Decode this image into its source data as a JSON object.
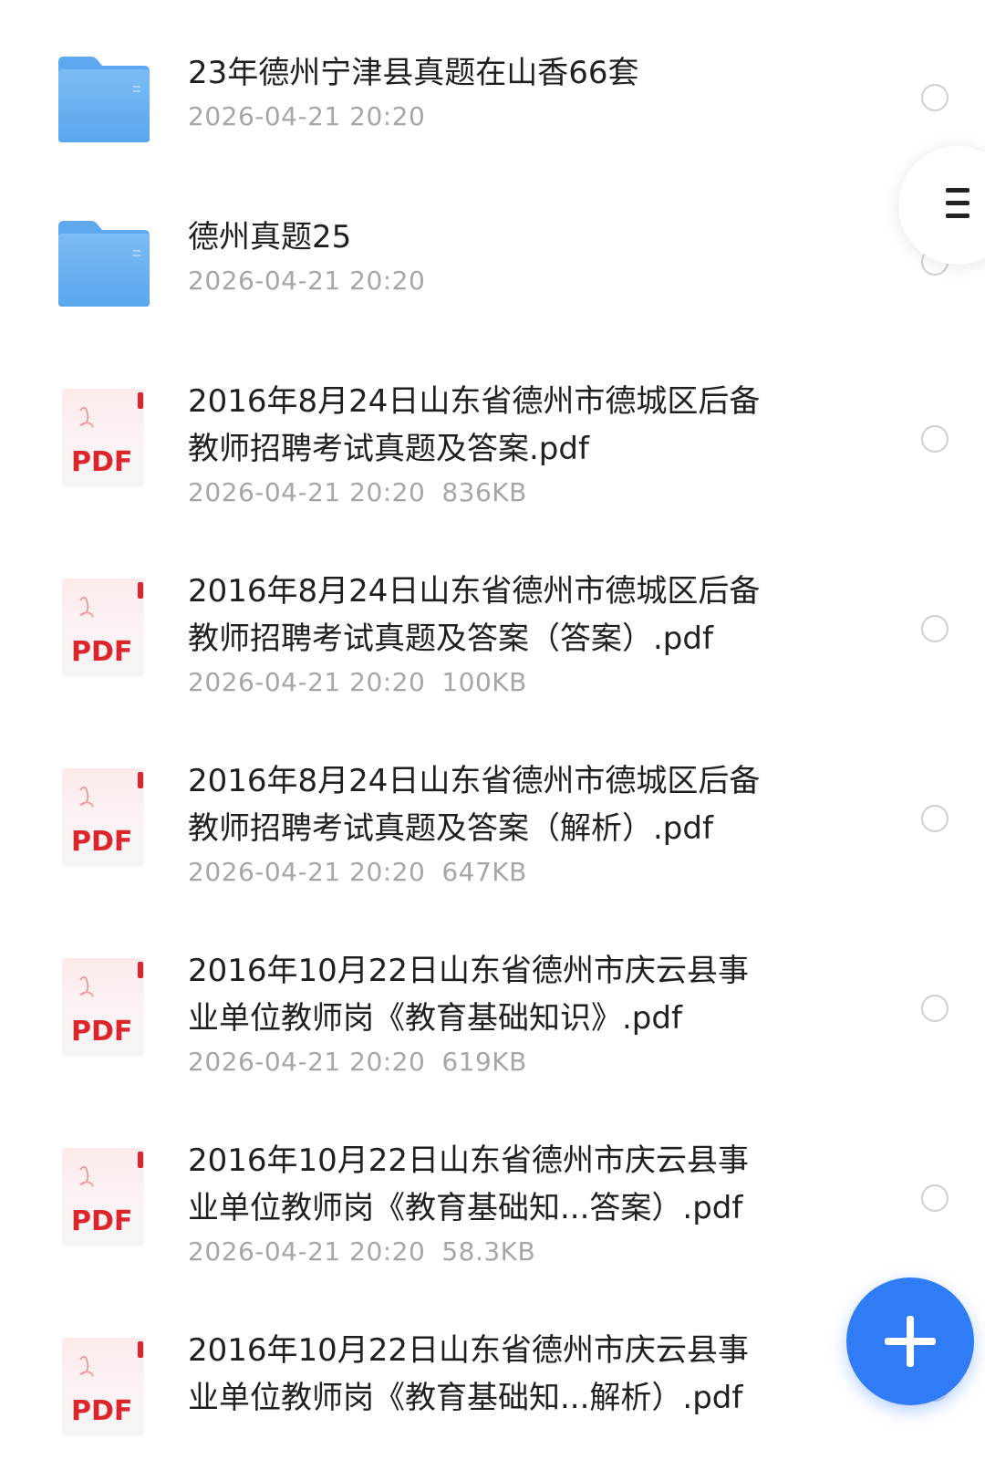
{
  "files": [
    {
      "type": "folder",
      "name_lines": [
        "23年德州宁津县真题在山香66套"
      ],
      "date": "2026-04-21 20:20",
      "size": ""
    },
    {
      "type": "folder",
      "name_lines": [
        "德州真题25"
      ],
      "date": "2026-04-21 20:20",
      "size": ""
    },
    {
      "type": "pdf",
      "name_lines": [
        "2016年8月24日山东省德州市德城区后备",
        "教师招聘考试真题及答案.pdf"
      ],
      "date": "2026-04-21 20:20",
      "size": "836KB"
    },
    {
      "type": "pdf",
      "name_lines": [
        "2016年8月24日山东省德州市德城区后备",
        "教师招聘考试真题及答案（答案）.pdf"
      ],
      "date": "2026-04-21 20:20",
      "size": "100KB"
    },
    {
      "type": "pdf",
      "name_lines": [
        "2016年8月24日山东省德州市德城区后备",
        "教师招聘考试真题及答案（解析）.pdf"
      ],
      "date": "2026-04-21 20:20",
      "size": "647KB"
    },
    {
      "type": "pdf",
      "name_lines": [
        "2016年10月22日山东省德州市庆云县事",
        "业单位教师岗《教育基础知识》.pdf"
      ],
      "date": "2026-04-21 20:20",
      "size": "619KB"
    },
    {
      "type": "pdf",
      "name_lines": [
        "2016年10月22日山东省德州市庆云县事",
        "业单位教师岗《教育基础知...答案）.pdf"
      ],
      "date": "2026-04-21 20:20",
      "size": "58.3KB"
    },
    {
      "type": "pdf",
      "name_lines": [
        "2016年10月22日山东省德州市庆云县事",
        "业单位教师岗《教育基础知...解析）.pdf"
      ],
      "date": "",
      "size": ""
    }
  ],
  "pdf_icon_label": "PDF",
  "icons": {
    "folder": "folder-icon",
    "pdf": "pdf-file-icon",
    "radio": "select-radio-icon",
    "side_tab": "menu-icon",
    "fab": "plus-icon"
  },
  "colors": {
    "folder": "#6fb2f2",
    "pdf_red": "#d9252b",
    "accent": "#2f7cf6",
    "meta_text": "#a6a6a6"
  }
}
